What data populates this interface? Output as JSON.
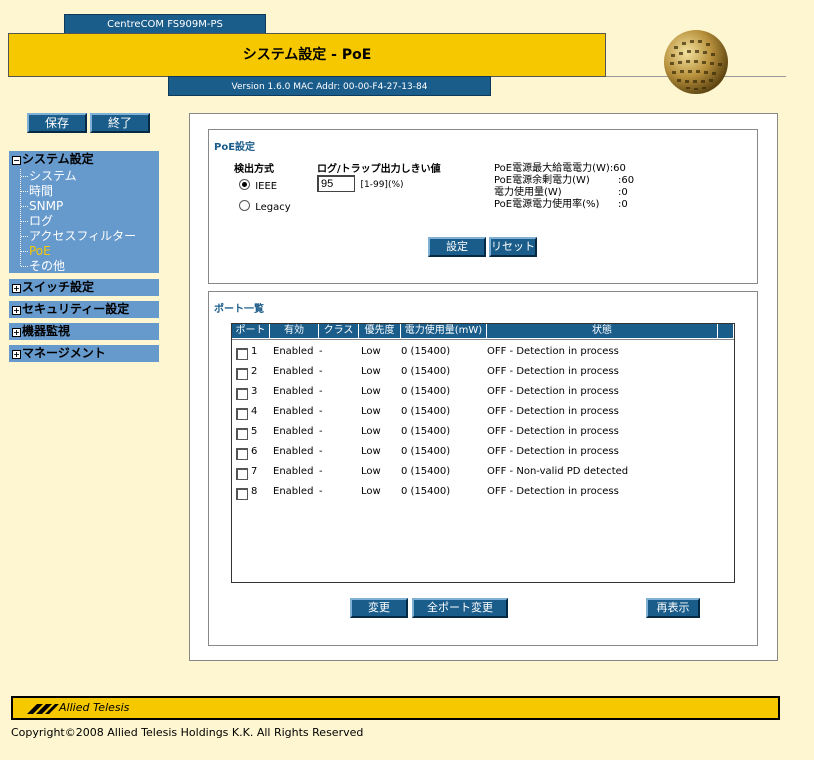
{
  "header": {
    "model": "CentreCOM FS909M-PS",
    "title": "システム設定 - PoE",
    "version": "Version 1.6.0 MAC Addr: 00-00-F4-27-13-84"
  },
  "toolbar": {
    "save_label": "保存",
    "exit_label": "終了"
  },
  "sidebar": {
    "system_settings": "システム設定",
    "items": [
      {
        "label": "システム"
      },
      {
        "label": "時間"
      },
      {
        "label": "SNMP"
      },
      {
        "label": "ログ"
      },
      {
        "label": "アクセスフィルター"
      },
      {
        "label": "PoE"
      },
      {
        "label": "その他"
      }
    ],
    "switch_settings": "スイッチ設定",
    "security_settings": "セキュリティー設定",
    "device_monitoring": "機器監視",
    "management": "マネージメント"
  },
  "poe_settings": {
    "title": "PoE設定",
    "detection_label": "検出方式",
    "ieee_label": "IEEE",
    "legacy_label": "Legacy",
    "threshold_label": "ログ/トラップ出力しきい値",
    "threshold_value": "95",
    "threshold_range": "[1-99](%)",
    "max_power_label": "PoE電源最大給電電力(W)",
    "max_power_value": ":60",
    "surplus_label": "PoE電源余剰電力(W)",
    "surplus_value": ":60",
    "usage_label": "電力使用量(W)",
    "usage_value": ":0",
    "usage_rate_label": "PoE電源電力使用率(%)",
    "usage_rate_value": ":0",
    "apply_label": "設定",
    "reset_label": "リセット"
  },
  "port_list": {
    "title": "ポート一覧",
    "headers": [
      "ポート",
      "有効",
      "クラス",
      "優先度",
      "電力使用量(mW)",
      "状態"
    ],
    "rows": [
      {
        "port": "1",
        "enabled": "Enabled",
        "class": "-",
        "priority": "Low",
        "power": "0 (15400)",
        "status": "OFF - Detection in process"
      },
      {
        "port": "2",
        "enabled": "Enabled",
        "class": "-",
        "priority": "Low",
        "power": "0 (15400)",
        "status": "OFF - Detection in process"
      },
      {
        "port": "3",
        "enabled": "Enabled",
        "class": "-",
        "priority": "Low",
        "power": "0 (15400)",
        "status": "OFF - Detection in process"
      },
      {
        "port": "4",
        "enabled": "Enabled",
        "class": "-",
        "priority": "Low",
        "power": "0 (15400)",
        "status": "OFF - Detection in process"
      },
      {
        "port": "5",
        "enabled": "Enabled",
        "class": "-",
        "priority": "Low",
        "power": "0 (15400)",
        "status": "OFF - Detection in process"
      },
      {
        "port": "6",
        "enabled": "Enabled",
        "class": "-",
        "priority": "Low",
        "power": "0 (15400)",
        "status": "OFF - Detection in process"
      },
      {
        "port": "7",
        "enabled": "Enabled",
        "class": "-",
        "priority": "Low",
        "power": "0 (15400)",
        "status": "OFF - Non-valid PD detected"
      },
      {
        "port": "8",
        "enabled": "Enabled",
        "class": "-",
        "priority": "Low",
        "power": "0 (15400)",
        "status": "OFF - Detection in process"
      }
    ],
    "change_label": "変更",
    "change_all_label": "全ポート変更",
    "refresh_label": "再表示"
  },
  "footer": {
    "brand": "Allied Telesis",
    "copyright": "Copyright©2008 Allied Telesis Holdings K.K. All Rights Reserved"
  },
  "colors": {
    "background": "#fdf6d0",
    "brand_yellow": "#f5c800",
    "brand_blue": "#1a5c8a",
    "nav_blue": "#6699cc",
    "active_item": "#f5c800"
  }
}
